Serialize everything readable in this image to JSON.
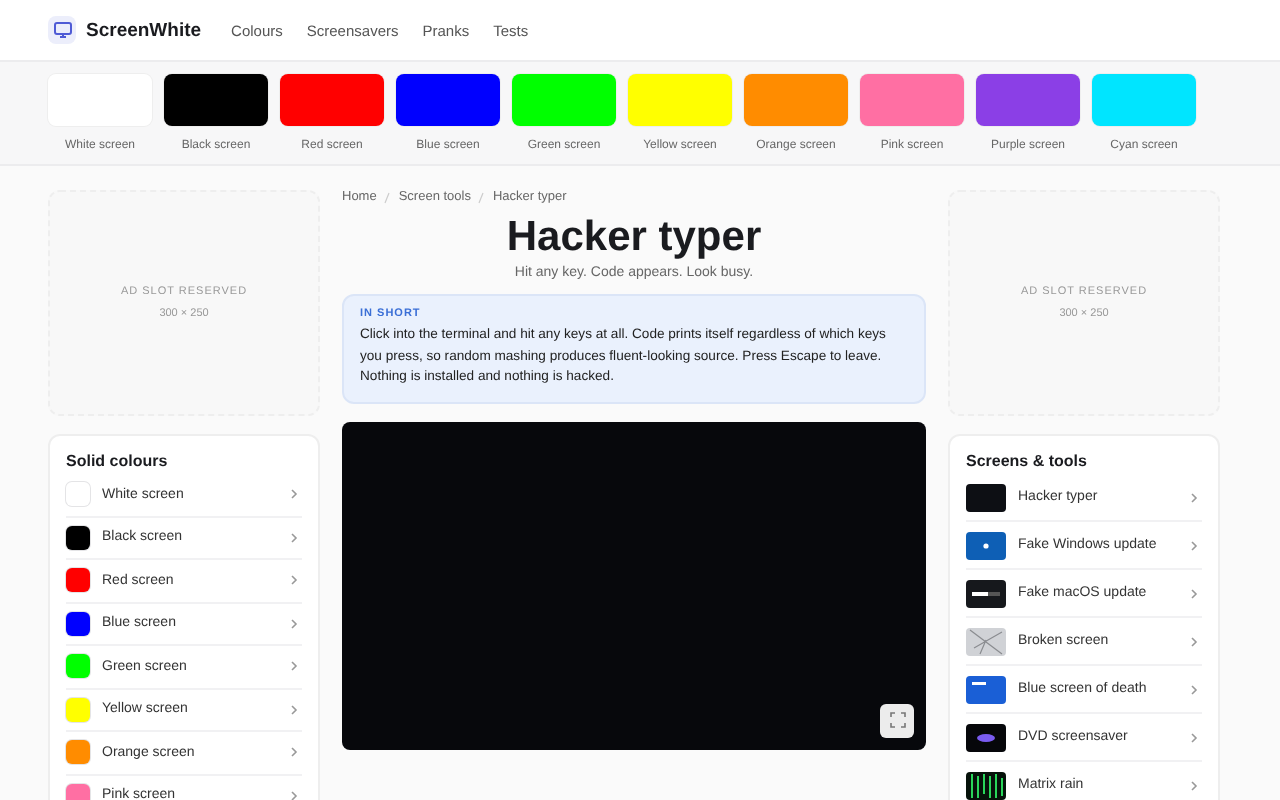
{
  "header": {
    "brand": "ScreenWhite",
    "nav": [
      "Colours",
      "Screensavers",
      "Pranks",
      "Tests"
    ]
  },
  "swatches": [
    {
      "label": "White screen",
      "color": "#ffffff"
    },
    {
      "label": "Black screen",
      "color": "#000000"
    },
    {
      "label": "Red screen",
      "color": "#ff0000"
    },
    {
      "label": "Blue screen",
      "color": "#0000ff"
    },
    {
      "label": "Green screen",
      "color": "#00ff00"
    },
    {
      "label": "Yellow screen",
      "color": "#ffff00"
    },
    {
      "label": "Orange screen",
      "color": "#ff8c00"
    },
    {
      "label": "Pink screen",
      "color": "#ff6fa3"
    },
    {
      "label": "Purple screen",
      "color": "#8b3fe6"
    },
    {
      "label": "Cyan screen",
      "color": "#00e5ff"
    }
  ],
  "ads": [
    {
      "title": "AD SLOT RESERVED",
      "size": "300 × 250"
    },
    {
      "title": "AD SLOT RESERVED",
      "size": "300 × 250"
    }
  ],
  "breadcrumb": [
    "Home",
    "Screen tools",
    "Hacker typer"
  ],
  "title": "Hacker typer",
  "subtitle": "Hit any key. Code appears. Look busy.",
  "info": {
    "label": "IN SHORT",
    "text": "Click into the terminal and hit any keys at all. Code prints itself regardless of which keys you press, so random mashing produces fluent-looking source. Press Escape to leave. Nothing is installed and nothing is hacked."
  },
  "solid_colours": {
    "title": "Solid colours",
    "items": [
      {
        "label": "White screen",
        "color": "#ffffff"
      },
      {
        "label": "Black screen",
        "color": "#000000"
      },
      {
        "label": "Red screen",
        "color": "#ff0000"
      },
      {
        "label": "Blue screen",
        "color": "#0000ff"
      },
      {
        "label": "Green screen",
        "color": "#00ff00"
      },
      {
        "label": "Yellow screen",
        "color": "#ffff00"
      },
      {
        "label": "Orange screen",
        "color": "#ff8c00"
      },
      {
        "label": "Pink screen",
        "color": "#ff6fa3"
      }
    ]
  },
  "tools": {
    "title": "Screens & tools",
    "items": [
      {
        "label": "Hacker typer",
        "kind": "terminal"
      },
      {
        "label": "Fake Windows update",
        "kind": "windows"
      },
      {
        "label": "Fake macOS update",
        "kind": "macos"
      },
      {
        "label": "Broken screen",
        "kind": "broken"
      },
      {
        "label": "Blue screen of death",
        "kind": "bsod"
      },
      {
        "label": "DVD screensaver",
        "kind": "dvd"
      },
      {
        "label": "Matrix rain",
        "kind": "matrix"
      }
    ]
  }
}
